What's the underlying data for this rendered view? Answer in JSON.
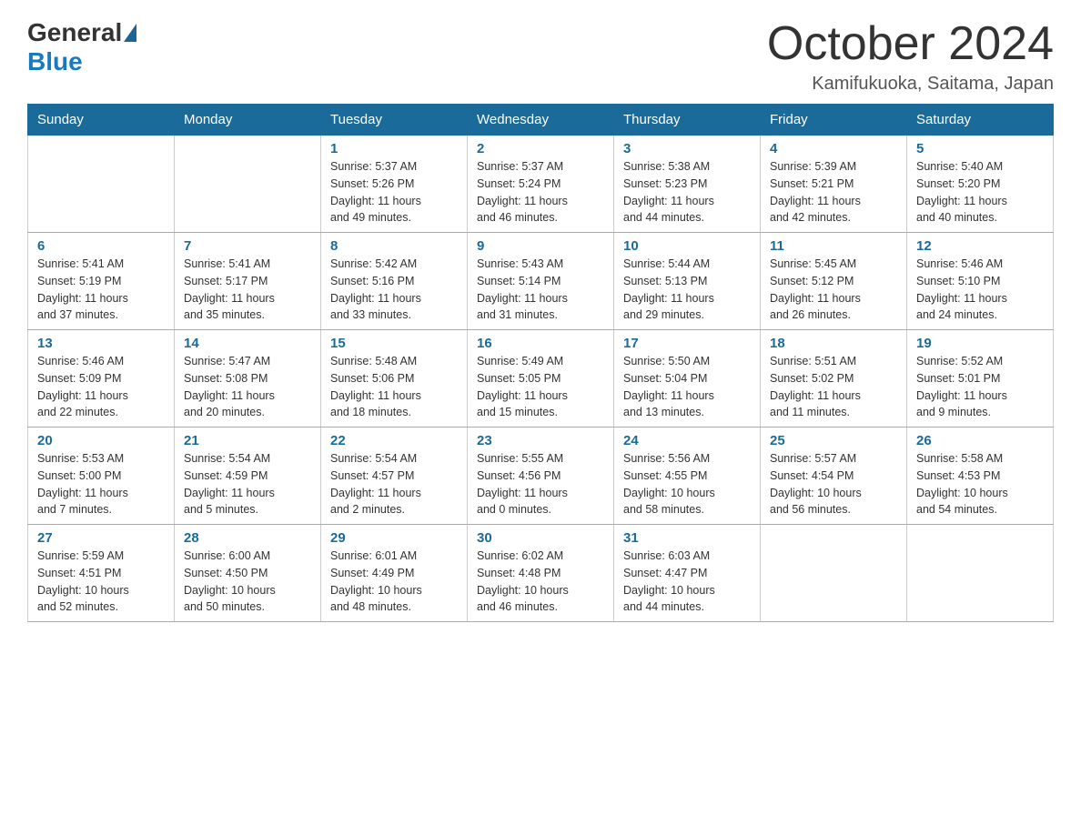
{
  "header": {
    "logo_general": "General",
    "logo_blue": "Blue",
    "month_title": "October 2024",
    "location": "Kamifukuoka, Saitama, Japan"
  },
  "weekdays": [
    "Sunday",
    "Monday",
    "Tuesday",
    "Wednesday",
    "Thursday",
    "Friday",
    "Saturday"
  ],
  "weeks": [
    [
      {
        "day": "",
        "info": ""
      },
      {
        "day": "",
        "info": ""
      },
      {
        "day": "1",
        "info": "Sunrise: 5:37 AM\nSunset: 5:26 PM\nDaylight: 11 hours\nand 49 minutes."
      },
      {
        "day": "2",
        "info": "Sunrise: 5:37 AM\nSunset: 5:24 PM\nDaylight: 11 hours\nand 46 minutes."
      },
      {
        "day": "3",
        "info": "Sunrise: 5:38 AM\nSunset: 5:23 PM\nDaylight: 11 hours\nand 44 minutes."
      },
      {
        "day": "4",
        "info": "Sunrise: 5:39 AM\nSunset: 5:21 PM\nDaylight: 11 hours\nand 42 minutes."
      },
      {
        "day": "5",
        "info": "Sunrise: 5:40 AM\nSunset: 5:20 PM\nDaylight: 11 hours\nand 40 minutes."
      }
    ],
    [
      {
        "day": "6",
        "info": "Sunrise: 5:41 AM\nSunset: 5:19 PM\nDaylight: 11 hours\nand 37 minutes."
      },
      {
        "day": "7",
        "info": "Sunrise: 5:41 AM\nSunset: 5:17 PM\nDaylight: 11 hours\nand 35 minutes."
      },
      {
        "day": "8",
        "info": "Sunrise: 5:42 AM\nSunset: 5:16 PM\nDaylight: 11 hours\nand 33 minutes."
      },
      {
        "day": "9",
        "info": "Sunrise: 5:43 AM\nSunset: 5:14 PM\nDaylight: 11 hours\nand 31 minutes."
      },
      {
        "day": "10",
        "info": "Sunrise: 5:44 AM\nSunset: 5:13 PM\nDaylight: 11 hours\nand 29 minutes."
      },
      {
        "day": "11",
        "info": "Sunrise: 5:45 AM\nSunset: 5:12 PM\nDaylight: 11 hours\nand 26 minutes."
      },
      {
        "day": "12",
        "info": "Sunrise: 5:46 AM\nSunset: 5:10 PM\nDaylight: 11 hours\nand 24 minutes."
      }
    ],
    [
      {
        "day": "13",
        "info": "Sunrise: 5:46 AM\nSunset: 5:09 PM\nDaylight: 11 hours\nand 22 minutes."
      },
      {
        "day": "14",
        "info": "Sunrise: 5:47 AM\nSunset: 5:08 PM\nDaylight: 11 hours\nand 20 minutes."
      },
      {
        "day": "15",
        "info": "Sunrise: 5:48 AM\nSunset: 5:06 PM\nDaylight: 11 hours\nand 18 minutes."
      },
      {
        "day": "16",
        "info": "Sunrise: 5:49 AM\nSunset: 5:05 PM\nDaylight: 11 hours\nand 15 minutes."
      },
      {
        "day": "17",
        "info": "Sunrise: 5:50 AM\nSunset: 5:04 PM\nDaylight: 11 hours\nand 13 minutes."
      },
      {
        "day": "18",
        "info": "Sunrise: 5:51 AM\nSunset: 5:02 PM\nDaylight: 11 hours\nand 11 minutes."
      },
      {
        "day": "19",
        "info": "Sunrise: 5:52 AM\nSunset: 5:01 PM\nDaylight: 11 hours\nand 9 minutes."
      }
    ],
    [
      {
        "day": "20",
        "info": "Sunrise: 5:53 AM\nSunset: 5:00 PM\nDaylight: 11 hours\nand 7 minutes."
      },
      {
        "day": "21",
        "info": "Sunrise: 5:54 AM\nSunset: 4:59 PM\nDaylight: 11 hours\nand 5 minutes."
      },
      {
        "day": "22",
        "info": "Sunrise: 5:54 AM\nSunset: 4:57 PM\nDaylight: 11 hours\nand 2 minutes."
      },
      {
        "day": "23",
        "info": "Sunrise: 5:55 AM\nSunset: 4:56 PM\nDaylight: 11 hours\nand 0 minutes."
      },
      {
        "day": "24",
        "info": "Sunrise: 5:56 AM\nSunset: 4:55 PM\nDaylight: 10 hours\nand 58 minutes."
      },
      {
        "day": "25",
        "info": "Sunrise: 5:57 AM\nSunset: 4:54 PM\nDaylight: 10 hours\nand 56 minutes."
      },
      {
        "day": "26",
        "info": "Sunrise: 5:58 AM\nSunset: 4:53 PM\nDaylight: 10 hours\nand 54 minutes."
      }
    ],
    [
      {
        "day": "27",
        "info": "Sunrise: 5:59 AM\nSunset: 4:51 PM\nDaylight: 10 hours\nand 52 minutes."
      },
      {
        "day": "28",
        "info": "Sunrise: 6:00 AM\nSunset: 4:50 PM\nDaylight: 10 hours\nand 50 minutes."
      },
      {
        "day": "29",
        "info": "Sunrise: 6:01 AM\nSunset: 4:49 PM\nDaylight: 10 hours\nand 48 minutes."
      },
      {
        "day": "30",
        "info": "Sunrise: 6:02 AM\nSunset: 4:48 PM\nDaylight: 10 hours\nand 46 minutes."
      },
      {
        "day": "31",
        "info": "Sunrise: 6:03 AM\nSunset: 4:47 PM\nDaylight: 10 hours\nand 44 minutes."
      },
      {
        "day": "",
        "info": ""
      },
      {
        "day": "",
        "info": ""
      }
    ]
  ]
}
